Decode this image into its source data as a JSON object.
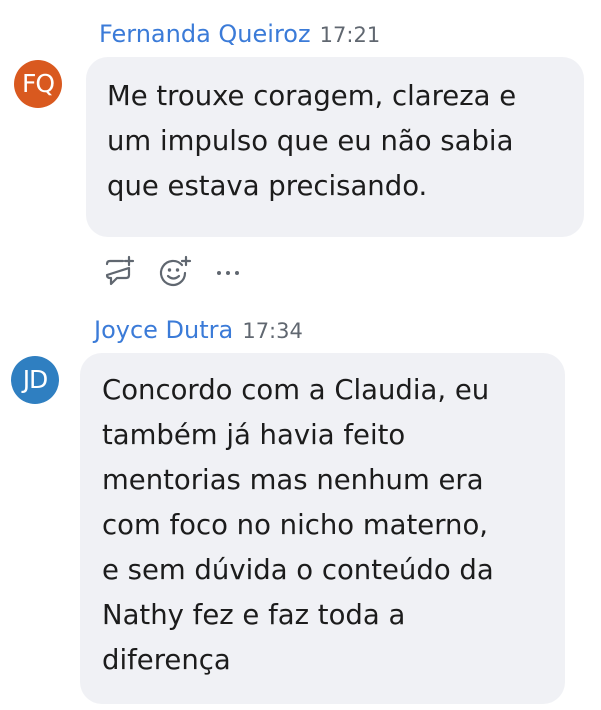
{
  "messages": [
    {
      "sender": "Fernanda Queiroz",
      "time": "17:21",
      "initials": "FQ",
      "avatar_color": "#d9591f",
      "lines": [
        "Me trouxe coragem, clareza e",
        "um impulso que eu não sabia",
        "que estava precisando."
      ]
    },
    {
      "sender": "Joyce Dutra",
      "time": "17:34",
      "initials": "JD",
      "avatar_color": "#2f7fc1",
      "lines": [
        "Concordo com a Claudia, eu",
        "também já havia feito",
        "mentorias mas nenhum era",
        "com foco no nicho materno,",
        "e sem dúvida o conteúdo da",
        "Nathy fez e faz toda a",
        "diferença"
      ]
    }
  ],
  "actions": {
    "icons": [
      "reply-icon",
      "add-reaction-icon",
      "more-options-icon"
    ]
  },
  "colors": {
    "sender_name": "#3b7bd8",
    "bubble_bg": "#f0f1f5",
    "icon": "#606770"
  }
}
